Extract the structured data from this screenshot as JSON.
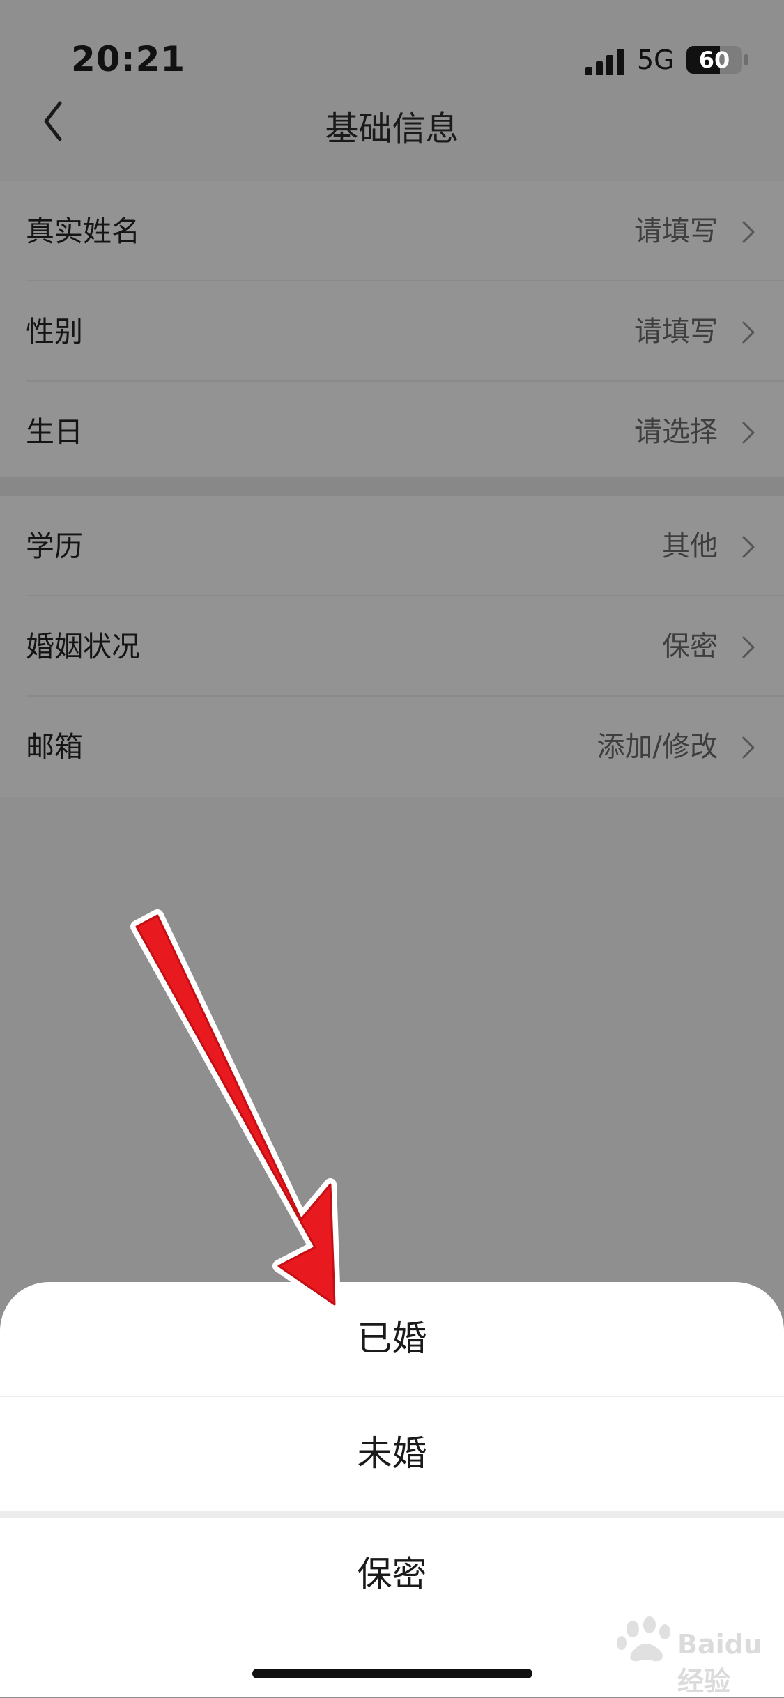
{
  "status_bar": {
    "time": "20:21",
    "network": "5G",
    "battery": "60",
    "battery_level": 0.6
  },
  "nav": {
    "title": "基础信息",
    "back_icon": "chevron-left-icon"
  },
  "group1": [
    {
      "label": "真实姓名",
      "value": "请填写"
    },
    {
      "label": "性别",
      "value": "请填写"
    },
    {
      "label": "生日",
      "value": "请选择"
    }
  ],
  "group2": [
    {
      "label": "学历",
      "value": "其他"
    },
    {
      "label": "婚姻状况",
      "value": "保密"
    },
    {
      "label": "邮箱",
      "value": "添加/修改"
    }
  ],
  "sheet": {
    "options": [
      "已婚",
      "未婚"
    ],
    "cancel": "保密"
  },
  "annotation": {
    "arrow_color": "#e8191f",
    "icon": "red-arrow-icon"
  },
  "watermark": {
    "text": "Baidu经验",
    "icon": "baidu-paw-icon"
  }
}
